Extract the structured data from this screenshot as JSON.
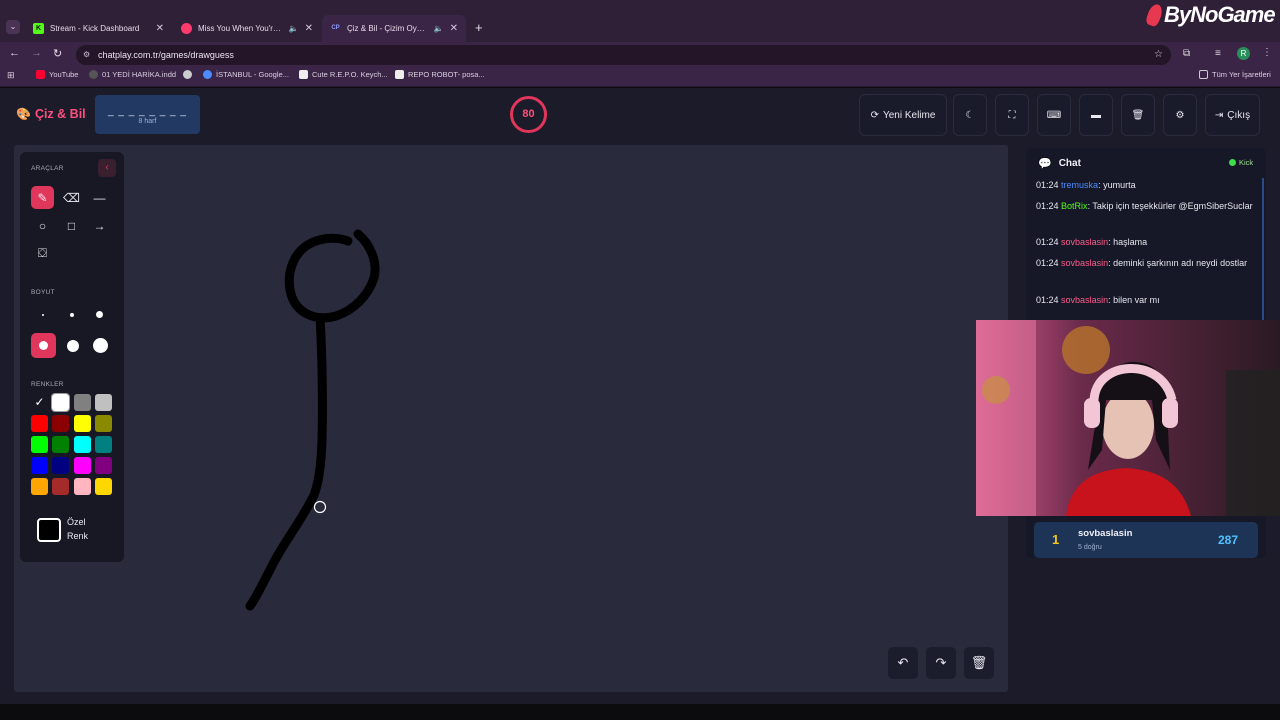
{
  "browser": {
    "tabs": [
      {
        "title": "Stream - Kick Dashboard",
        "favicon": "kick-icon",
        "color": "#53fc18"
      },
      {
        "title": "Miss You When You're Then",
        "favicon": "music-icon",
        "color": "#ff3b6b"
      },
      {
        "title": "Çiz & Bil - Çizim Oyunu",
        "favicon": "cp-icon",
        "color": "#6a7bff"
      }
    ],
    "url": "chatplay.com.tr/games/drawguess",
    "bookmarks": [
      "YouTube",
      "01 YEDİ HARİKA.indd",
      "İSTANBUL - Google...",
      "Cute R.E.P.O. Keych...",
      "REPO ROBOT- posa..."
    ],
    "all_bookmarks": "Tüm Yer İşaretleri",
    "profile_initial": "R"
  },
  "watermark": "ByNoGame",
  "app": {
    "logo": "Çiz & Bil",
    "word_mask": "_ _ _ _ _ _ _ _",
    "word_hint": "8 harf",
    "timer": "80",
    "buttons": {
      "new_word": "Yeni Kelime",
      "exit": "Çıkış"
    }
  },
  "tools": {
    "section_tools": "ARAÇLAR",
    "section_size": "BOYUT",
    "section_colors": "RENKLER",
    "custom_color": "Özel Renk",
    "palette": [
      "#000000",
      "#ffffff",
      "#808080",
      "#c0c0c0",
      "#ff0000",
      "#8b0000",
      "#ffff00",
      "#8a8a00",
      "#00ff00",
      "#008000",
      "#00ffff",
      "#008080",
      "#0000ff",
      "#000080",
      "#ff00ff",
      "#800080",
      "#ffa500",
      "#a52a2a",
      "#ffb6c1",
      "#ffd700"
    ],
    "accent": "#e0365b"
  },
  "chat": {
    "title": "Chat",
    "source": "Kick",
    "messages": [
      {
        "time": "01:24",
        "user": "tremuska",
        "color": "#4a8cff",
        "text": ": yumurta"
      },
      {
        "time": "01:24",
        "user": "BotRix",
        "color": "#53fc18",
        "text": ": Takip için teşekkürler @EgmSiberSuclar"
      },
      {
        "time": "01:24",
        "user": "sovbaslasin",
        "color": "#ff5c8a",
        "text": ": haşlama"
      },
      {
        "time": "01:24",
        "user": "sovbaslasin",
        "color": "#ff5c8a",
        "text": ": deminki şarkının adı neydi dostlar"
      },
      {
        "time": "01:24",
        "user": "sovbaslasin",
        "color": "#ff5c8a",
        "text": ": bilen var mı"
      }
    ]
  },
  "scoreboard": [
    {
      "rank": "1",
      "name": "sovbaslasin",
      "detail": "5 doğru",
      "score": "287"
    }
  ]
}
